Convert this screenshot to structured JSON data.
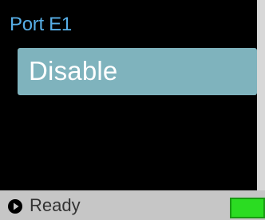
{
  "header": {
    "title": "Port E1"
  },
  "menu": {
    "items": [
      {
        "label": "Disable",
        "selected": true
      }
    ]
  },
  "status_bar": {
    "icon": "play-icon",
    "text": "Ready",
    "battery_icon": "battery-icon"
  },
  "colors": {
    "background": "#000000",
    "header_text": "#57aee6",
    "selection_bg": "#7fb3bd",
    "selection_text": "#ffffff",
    "status_bar_bg": "#c6c6c6",
    "status_text": "#333333",
    "battery": "#2bdc22"
  }
}
